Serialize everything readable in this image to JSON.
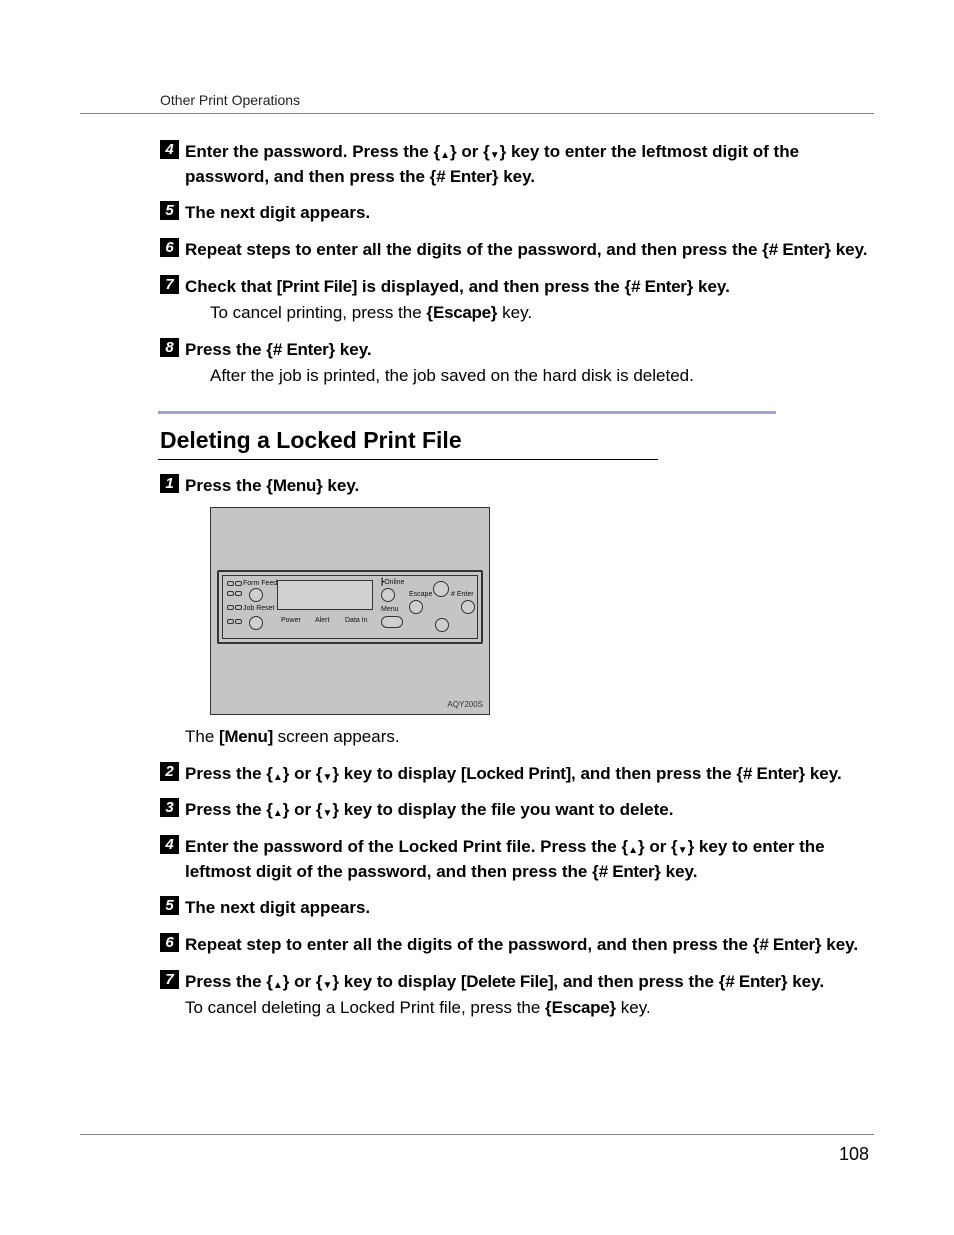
{
  "header": "Other Print Operations",
  "pageNumber": "108",
  "section1": {
    "s4": {
      "t1": "Enter the password. Press the ",
      "up": "▲",
      "t2": " or ",
      "down": "▼",
      "t3": " key to enter the leftmost digit of the password, and then press the ",
      "key": "# Enter",
      "t4": " key."
    },
    "s5": "The next digit appears.",
    "s6": {
      "t1": "Repeat steps to enter all the digits of the password, and then press the ",
      "key": "# Enter",
      "t2": " key."
    },
    "s7": {
      "t1": "Check that ",
      "pf": "[Print File]",
      "t2": " is displayed, and then press the ",
      "key": "# Enter",
      "t3": " key.",
      "note1": "To cancel printing, press the ",
      "esc": "Escape",
      "note2": " key."
    },
    "s8": {
      "t1": "Press the ",
      "key": "# Enter",
      "t2": " key.",
      "note": "After the job is printed, the job saved on the hard disk is deleted."
    }
  },
  "heading": "Deleting a Locked Print File",
  "section2": {
    "s1": {
      "t1": "Press the ",
      "key": "Menu",
      "t2": " key.",
      "note1": "The ",
      "menu": "[Menu]",
      "note2": " screen appears."
    },
    "s2": {
      "t1": "Press the ",
      "up": "▲",
      "t2": " or ",
      "down": "▼",
      "t3": " key to display ",
      "lp": "[Locked Print]",
      "t4": ", and then press the ",
      "key": "# Enter",
      "t5": " key."
    },
    "s3": {
      "t1": "Press the ",
      "up": "▲",
      "t2": " or ",
      "down": "▼",
      "t3": " key to display the file you want to delete."
    },
    "s4": {
      "t1": "Enter the password of the Locked Print file. Press the ",
      "up": "▲",
      "t2": " or ",
      "down": "▼",
      "t3": " key to enter the leftmost digit of the password, and then press the ",
      "key": "# Enter",
      "t4": " key."
    },
    "s5": "The next digit appears.",
    "s6": {
      "t1": "Repeat step to enter all the digits of the password, and then press the ",
      "key": "# Enter",
      "t2": " key."
    },
    "s7": {
      "t1": "Press the ",
      "up": "▲",
      "t2": " or ",
      "down": "▼",
      "t3": " key to display ",
      "df": "[Delete File]",
      "t4": ", and then press the ",
      "key": "# Enter",
      "t5": " key.",
      "note1": "To cancel deleting a Locked Print file, press the ",
      "esc": "Escape",
      "note2": " key."
    }
  },
  "panel": {
    "formFeed": "Form Feed",
    "jobReset": "Job Reset",
    "power": "Power",
    "alert": "Alert",
    "dataIn": "Data In",
    "menu": "Menu",
    "online": "Online",
    "escape": "Escape",
    "enter": "# Enter",
    "code": "AQY200S"
  }
}
